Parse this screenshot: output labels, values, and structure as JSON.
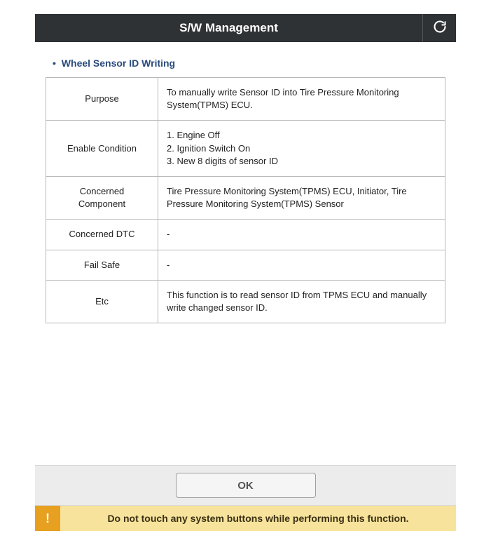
{
  "header": {
    "title": "S/W Management"
  },
  "section": {
    "title": "Wheel Sensor ID Writing"
  },
  "rows": {
    "purpose": {
      "label": "Purpose",
      "value": "To manually write Sensor ID into Tire Pressure Monitoring System(TPMS) ECU."
    },
    "enable_condition": {
      "label": "Enable Condition",
      "line1": "1. Engine Off",
      "line2": "2. Ignition Switch On",
      "line3": "3. New 8 digits of sensor ID"
    },
    "concerned_component": {
      "label": "Concerned Component",
      "value": "Tire Pressure Monitoring System(TPMS) ECU, Initiator, Tire Pressure Monitoring System(TPMS) Sensor"
    },
    "concerned_dtc": {
      "label": "Concerned DTC",
      "value": "-"
    },
    "fail_safe": {
      "label": "Fail Safe",
      "value": "-"
    },
    "etc": {
      "label": "Etc",
      "value": "This function is to read sensor ID from TPMS ECU and manually write changed sensor ID."
    }
  },
  "footer": {
    "ok_label": "OK",
    "warning": "Do not touch any system buttons while performing this function."
  }
}
